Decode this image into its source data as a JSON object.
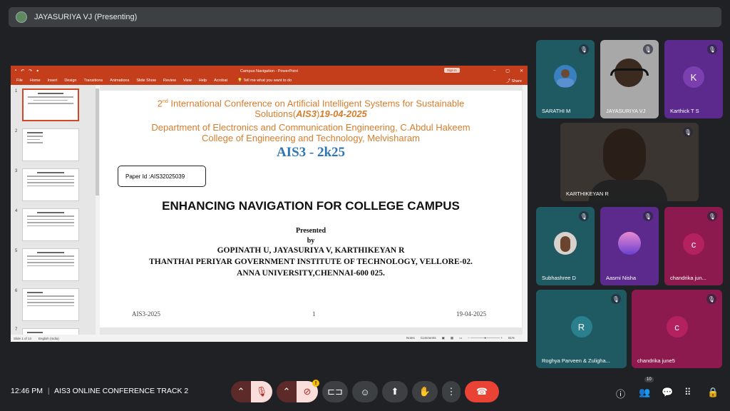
{
  "meet": {
    "presenter_label": "JAYASURIYA VJ (Presenting)",
    "time": "12:46 PM",
    "separator": "|",
    "meeting_name": "AIS3 ONLINE CONFERENCE TRACK 2",
    "people_count": "10"
  },
  "ppt": {
    "window_title": "Campus Navigation - PowerPoint",
    "sign_in": "Sign in",
    "menu": [
      "File",
      "Home",
      "Insert",
      "Design",
      "Transitions",
      "Animations",
      "Slide Show",
      "Review",
      "View",
      "Help",
      "Acrobat"
    ],
    "tell_me": "Tell me what you want to do",
    "share": "Share",
    "status_slide": "Slide 1 of 14",
    "status_lang": "English (India)",
    "status_notes": "Notes",
    "status_comments": "Comments",
    "zoom": "81%",
    "thumb_numbers": [
      "1",
      "2",
      "3",
      "4",
      "5",
      "6",
      "7"
    ]
  },
  "slide": {
    "conf_prefix": "2",
    "conf_sup": "nd",
    "conf_line1": " International Conference on Artificial Intelligent Systems for Sustainable",
    "conf_line2_a": "Solutions(",
    "conf_line2_b": "AIS3",
    "conf_line2_c": ")",
    "conf_line2_d": "19-04-2025",
    "dept_line1": "Department of Electronics and Communication Engineering, C.Abdul Hakeem",
    "dept_line2": "College of Engineering and Technology, Melvisharam",
    "ais_title": "AIS3 - 2k25",
    "paper_id": "Paper Id :AIS32025039",
    "main_title": "ENHANCING NAVIGATION FOR COLLEGE CAMPUS",
    "presented": "Presented",
    "by": "by",
    "authors": "GOPINATH U, JAYASURIYA V, KARTHIKEYAN R",
    "institute": "THANTHAI PERIYAR GOVERNMENT  INSTITUTE OF TECHNOLOGY, VELLORE-02.",
    "university": "ANNA UNIVERSITY,CHENNAI-600 025.",
    "footer_left": "AIS3-2025",
    "footer_center": "1",
    "footer_right": "19-04-2025"
  },
  "participants": [
    {
      "name": "SARATHI M"
    },
    {
      "name": "JAYASURIYA VJ"
    },
    {
      "name": "Karthick T S",
      "initial": "K"
    },
    {
      "name": "KARTHIKEYAN R"
    },
    {
      "name": "Subhashree D"
    },
    {
      "name": "Aasmi Nisha"
    },
    {
      "name": "chandrika jun...",
      "initial": "c"
    },
    {
      "name": "Roghya Parveen & Zuligha...",
      "initial": "R"
    },
    {
      "name": "chandrika june5",
      "initial": "c"
    }
  ],
  "colors": {
    "ppt_accent": "#c43e1c",
    "end_call": "#ea4335",
    "muted_button": "#f9dedc",
    "tile_teal": "#1f5a63",
    "tile_purple": "#5b2a8c",
    "tile_magenta": "#8d1a4f"
  },
  "icons": [
    "mic-off-icon",
    "camera-off-icon",
    "captions-icon",
    "emoji-icon",
    "present-icon",
    "raise-hand-icon",
    "more-options-icon",
    "end-call-icon",
    "info-icon",
    "people-icon",
    "chat-icon",
    "activities-icon",
    "host-controls-icon"
  ]
}
